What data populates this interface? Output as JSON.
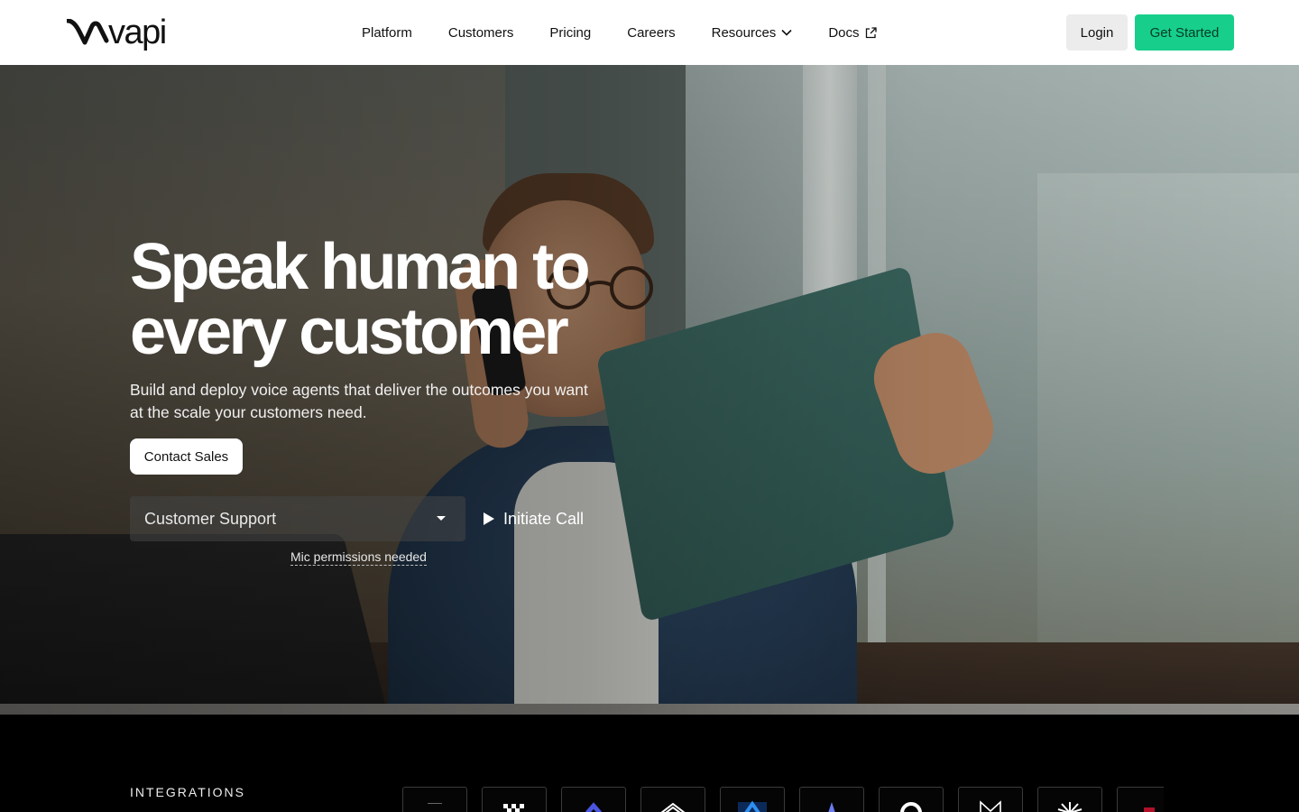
{
  "brand": {
    "name": "vapi"
  },
  "nav": {
    "items": [
      {
        "label": "Platform"
      },
      {
        "label": "Customers"
      },
      {
        "label": "Pricing"
      },
      {
        "label": "Careers"
      },
      {
        "label": "Resources",
        "icon": "chevron-down-icon"
      },
      {
        "label": "Docs",
        "icon": "external-link-icon"
      }
    ],
    "login_label": "Login",
    "cta_label": "Get Started"
  },
  "colors": {
    "accent": "#17cf8b",
    "header_bg": "#ffffff",
    "page_bg": "#000000"
  },
  "hero": {
    "title_line1": "Speak human to",
    "title_line2": "every customer",
    "subtitle": "Build and deploy voice agents that deliver the outcomes you want at the scale your customers need.",
    "contact_label": "Contact Sales",
    "select_value": "Customer Support",
    "call_label": "Initiate Call",
    "mic_note": "Mic permissions needed"
  },
  "integrations": {
    "title": "INTEGRATIONS",
    "logos": [
      "integration-logo-1",
      "integration-logo-2",
      "integration-logo-3",
      "integration-logo-4",
      "integration-logo-5",
      "integration-logo-6",
      "integration-logo-7",
      "integration-logo-8",
      "integration-logo-9",
      "integration-logo-10"
    ]
  }
}
